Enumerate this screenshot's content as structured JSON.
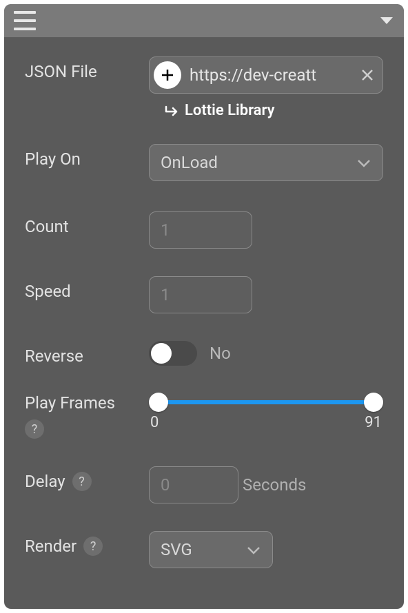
{
  "labels": {
    "jsonFile": "JSON File",
    "playOn": "Play On",
    "count": "Count",
    "speed": "Speed",
    "reverse": "Reverse",
    "playFrames": "Play Frames",
    "delay": "Delay",
    "render": "Render"
  },
  "jsonFile": {
    "value": "https://dev-creatt",
    "libraryLink": "Lottie Library"
  },
  "playOn": {
    "value": "OnLoad"
  },
  "count": {
    "placeholder": "1"
  },
  "speed": {
    "placeholder": "1"
  },
  "reverse": {
    "state": "No"
  },
  "playFrames": {
    "min": "0",
    "max": "91"
  },
  "delay": {
    "placeholder": "0",
    "unit": "Seconds"
  },
  "render": {
    "value": "SVG"
  },
  "helpGlyph": "?"
}
